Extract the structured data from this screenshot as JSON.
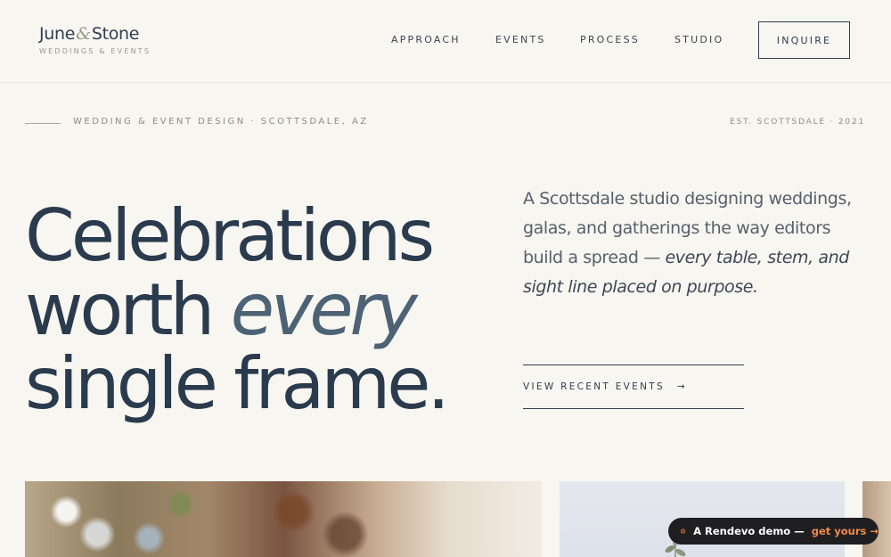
{
  "brand": {
    "name_part1": "June",
    "ampersand": "&",
    "name_part2": "Stone",
    "tagline": "WEDDINGS & EVENTS"
  },
  "nav": {
    "items": [
      {
        "label": "APPROACH"
      },
      {
        "label": "EVENTS"
      },
      {
        "label": "PROCESS"
      },
      {
        "label": "STUDIO"
      }
    ],
    "cta_label": "INQUIRE"
  },
  "hero": {
    "eyebrow": "WEDDING & EVENT DESIGN · SCOTTSDALE, AZ",
    "established": "EST. SCOTTSDALE · 2021",
    "headline_line1": "Celebrations",
    "headline_line2_plain": "worth ",
    "headline_line2_italic": "every",
    "headline_line3": "single frame.",
    "description_plain": "A Scottsdale studio designing weddings, galas, and gatherings the way editors build a spread — ",
    "description_italic": "every table, stem, and sight line placed on purpose.",
    "cta_label": "VIEW RECENT EVENTS",
    "cta_arrow": "→"
  },
  "badge": {
    "text": "A Rendevo demo —",
    "link": "get yours →"
  },
  "colors": {
    "background": "#f8f6f1",
    "navy": "#2b3b4e",
    "accent_link": "#f08a45"
  }
}
